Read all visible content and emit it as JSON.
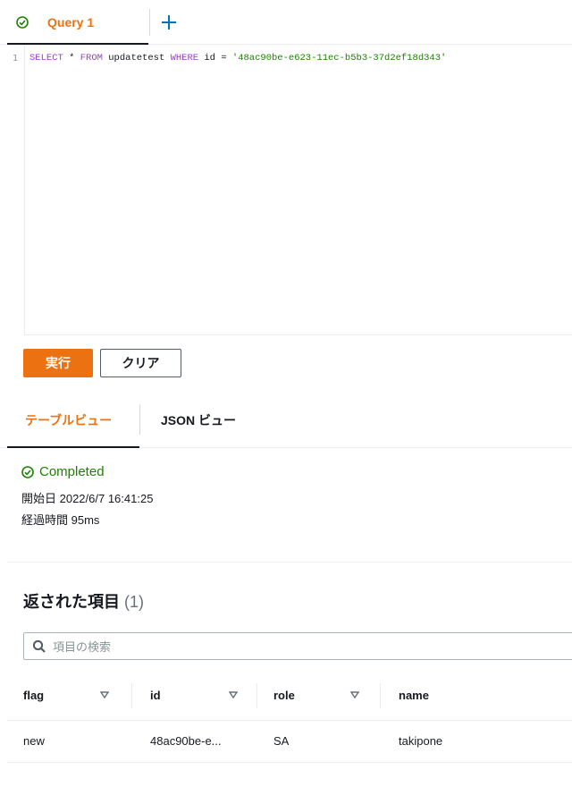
{
  "query_tabs": [
    {
      "label": "Query 1"
    }
  ],
  "editor": {
    "line_number": "1",
    "tokens": {
      "select": "SELECT",
      "star": " * ",
      "from": "FROM",
      "table": " updatetest ",
      "where": "WHERE",
      "cond": " id = ",
      "value": "'48ac90be-e623-11ec-b5b3-37d2ef18d343'"
    }
  },
  "buttons": {
    "run": "実行",
    "clear": "クリア"
  },
  "result_tabs": {
    "table": "テーブルビュー",
    "json": "JSON ビュー"
  },
  "status": {
    "text": "Completed",
    "started": "開始日 2022/6/7 16:41:25",
    "elapsed": "経過時間 95ms"
  },
  "results": {
    "title": "返された項目",
    "count": "(1)",
    "search_placeholder": "項目の検索",
    "columns": [
      "flag",
      "id",
      "role",
      "name"
    ],
    "rows": [
      [
        "new",
        "48ac90be-e...",
        "SA",
        "takipone"
      ]
    ]
  },
  "colors": {
    "accent": "#ec7211",
    "success": "#1d8102"
  },
  "icons": [
    "check-circle-icon",
    "plus-icon",
    "search-icon",
    "sort-down-icon"
  ]
}
